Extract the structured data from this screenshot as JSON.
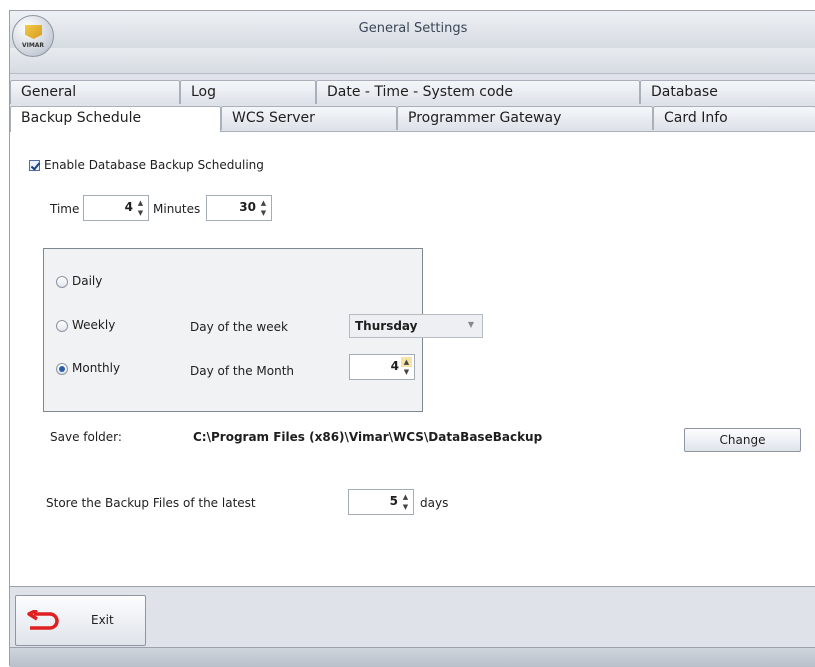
{
  "window": {
    "title": "General Settings",
    "logo_text": "VIMAR"
  },
  "tabs_back": [
    {
      "label": "General"
    },
    {
      "label": "Log"
    },
    {
      "label": "Date - Time - System code"
    },
    {
      "label": "Database"
    }
  ],
  "tabs_front": [
    {
      "label": "Backup Schedule",
      "active": true
    },
    {
      "label": "WCS Server"
    },
    {
      "label": "Programmer Gateway"
    },
    {
      "label": "Card Info"
    }
  ],
  "backup": {
    "enable_label": "Enable Database Backup Scheduling",
    "enable_checked": true,
    "time_label": "Time",
    "time_hours": "4",
    "minutes_label": "Minutes",
    "time_minutes": "30",
    "daily_label": "Daily",
    "weekly_label": "Weekly",
    "monthly_label": "Monthly",
    "selected_frequency": "Monthly",
    "day_of_week_label": "Day of the week",
    "day_of_week_value": "Thursday",
    "day_of_month_label": "Day of the Month",
    "day_of_month_value": "4",
    "save_folder_label": "Save folder:",
    "save_folder_path": "C:\\Program Files (x86)\\Vimar\\WCS\\DataBaseBackup",
    "change_button": "Change",
    "store_label": "Store the Backup Files of the latest",
    "store_value": "5",
    "store_unit": "days"
  },
  "footer": {
    "exit_button": "Exit"
  },
  "icons": {
    "logo": "vimar-logo-icon",
    "exit": "exit-arrow-icon",
    "spin": "spin-arrows-icon",
    "dropdown": "chevron-down-icon"
  },
  "colors": {
    "exit_icon": "#e02020",
    "accent": "#2b5ea8"
  }
}
